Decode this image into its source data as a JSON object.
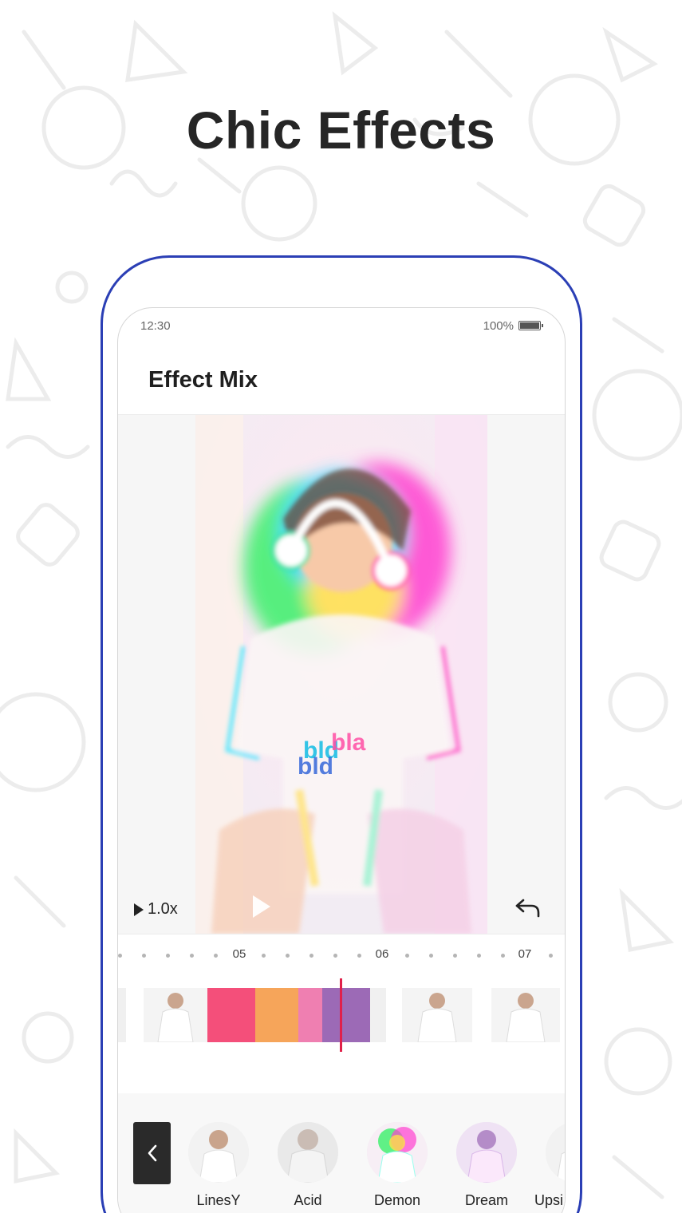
{
  "headline": "Chic Effects",
  "status_bar": {
    "time": "12:30",
    "battery": "100%"
  },
  "app": {
    "title": "Effect Mix"
  },
  "player": {
    "speed": "1.0x"
  },
  "timeline": {
    "ruler_labels": [
      "05",
      "06",
      "07"
    ]
  },
  "effects": [
    {
      "label": "LinesY"
    },
    {
      "label": "Acid"
    },
    {
      "label": "Demon"
    },
    {
      "label": "Dream"
    },
    {
      "label": "Upsi"
    }
  ],
  "colors": {
    "accent_frame": "#2b3fb5",
    "playhead": "#e0204a",
    "effect_segments": [
      "#f44f7a",
      "#f6a55a",
      "#ef7fb1",
      "#9c6ab6"
    ]
  }
}
